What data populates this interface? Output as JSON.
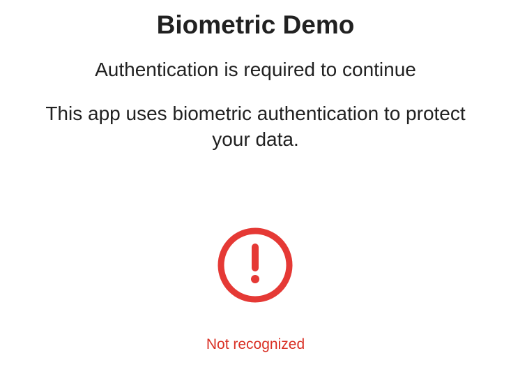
{
  "dialog": {
    "title": "Biometric Demo",
    "subtitle": "Authentication is required to continue",
    "description_lines": [
      "This app uses biometric authentication to protect",
      "your data."
    ],
    "status_icon": "error-circle-exclamation-icon",
    "status_text": "Not recognized",
    "error_color": "#d93025",
    "text_color": "#212121"
  }
}
